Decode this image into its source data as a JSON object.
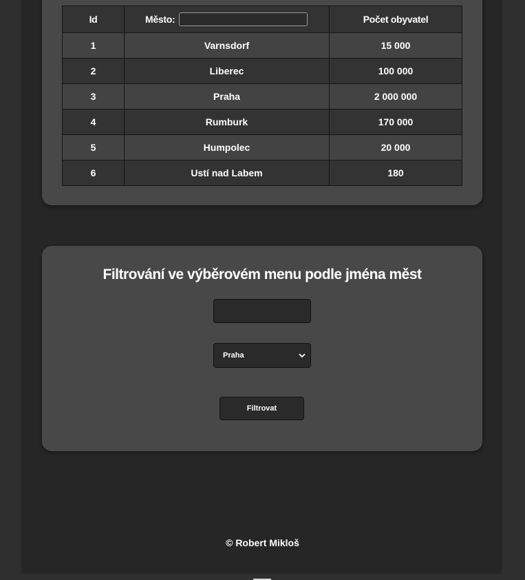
{
  "table": {
    "headers": {
      "id": "Id",
      "city": "Město:",
      "population": "Počet obyvatel"
    },
    "rows": [
      {
        "id": "1",
        "city": "Varnsdorf",
        "population": "15 000"
      },
      {
        "id": "2",
        "city": "Liberec",
        "population": "100 000"
      },
      {
        "id": "3",
        "city": "Praha",
        "population": "2 000 000"
      },
      {
        "id": "4",
        "city": "Rumburk",
        "population": "170 000"
      },
      {
        "id": "5",
        "city": "Humpolec",
        "population": "20 000"
      },
      {
        "id": "6",
        "city": "Ustí nad Labem",
        "population": "180"
      }
    ],
    "city_filter_value": ""
  },
  "filter": {
    "title": "Filtrování ve výběrovém menu podle jména měst",
    "input_value": "",
    "selected": "Praha",
    "button_label": "Filtrovat"
  },
  "footer": {
    "text": "© Robert Mikloš"
  },
  "colors": {
    "background": "#2f2f2f",
    "column": "#262626",
    "card": "#494849",
    "field": "#2b2a2b"
  }
}
